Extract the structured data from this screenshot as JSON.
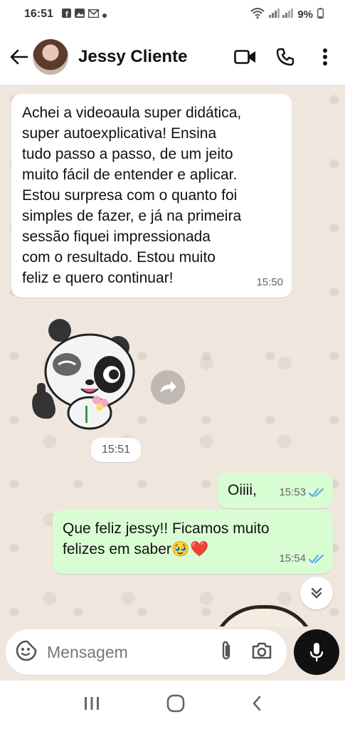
{
  "status_bar": {
    "time": "16:51",
    "notification_icons": [
      "facebook-icon",
      "gallery-icon",
      "gmail-icon",
      "dot-icon"
    ],
    "battery": "9%"
  },
  "header": {
    "contact_name": "Jessy Cliente"
  },
  "messages": [
    {
      "direction": "in",
      "text": "Achei a videoaula super didática,\nsuper autoexplicativa! Ensina\ntudo passo a passo, de um jeito\nmuito fácil de entender e aplicar.\nEstou surpresa com o quanto foi\nsimples de fazer, e já na primeira\nsessão fiquei impressionada\ncom o resultado. Estou muito\nfeliz e quero continuar!",
      "time": "15:50"
    },
    {
      "direction": "in",
      "type": "sticker",
      "sticker": "panda-thumbs-up",
      "time": "15:51"
    },
    {
      "direction": "out",
      "text": "Oiiii,",
      "time": "15:53",
      "status": "read"
    },
    {
      "direction": "out",
      "text": "Que feliz jessy!! Ficamos muito\nfelizes em saber🥹❤️",
      "time": "15:54",
      "status": "read"
    }
  ],
  "input": {
    "placeholder": "Mensagem"
  },
  "colors": {
    "incoming_bubble": "#ffffff",
    "outgoing_bubble": "#d9fdd3",
    "chat_background": "#efe7de",
    "read_ticks": "#4fa9e6",
    "mic_button": "#111111"
  }
}
